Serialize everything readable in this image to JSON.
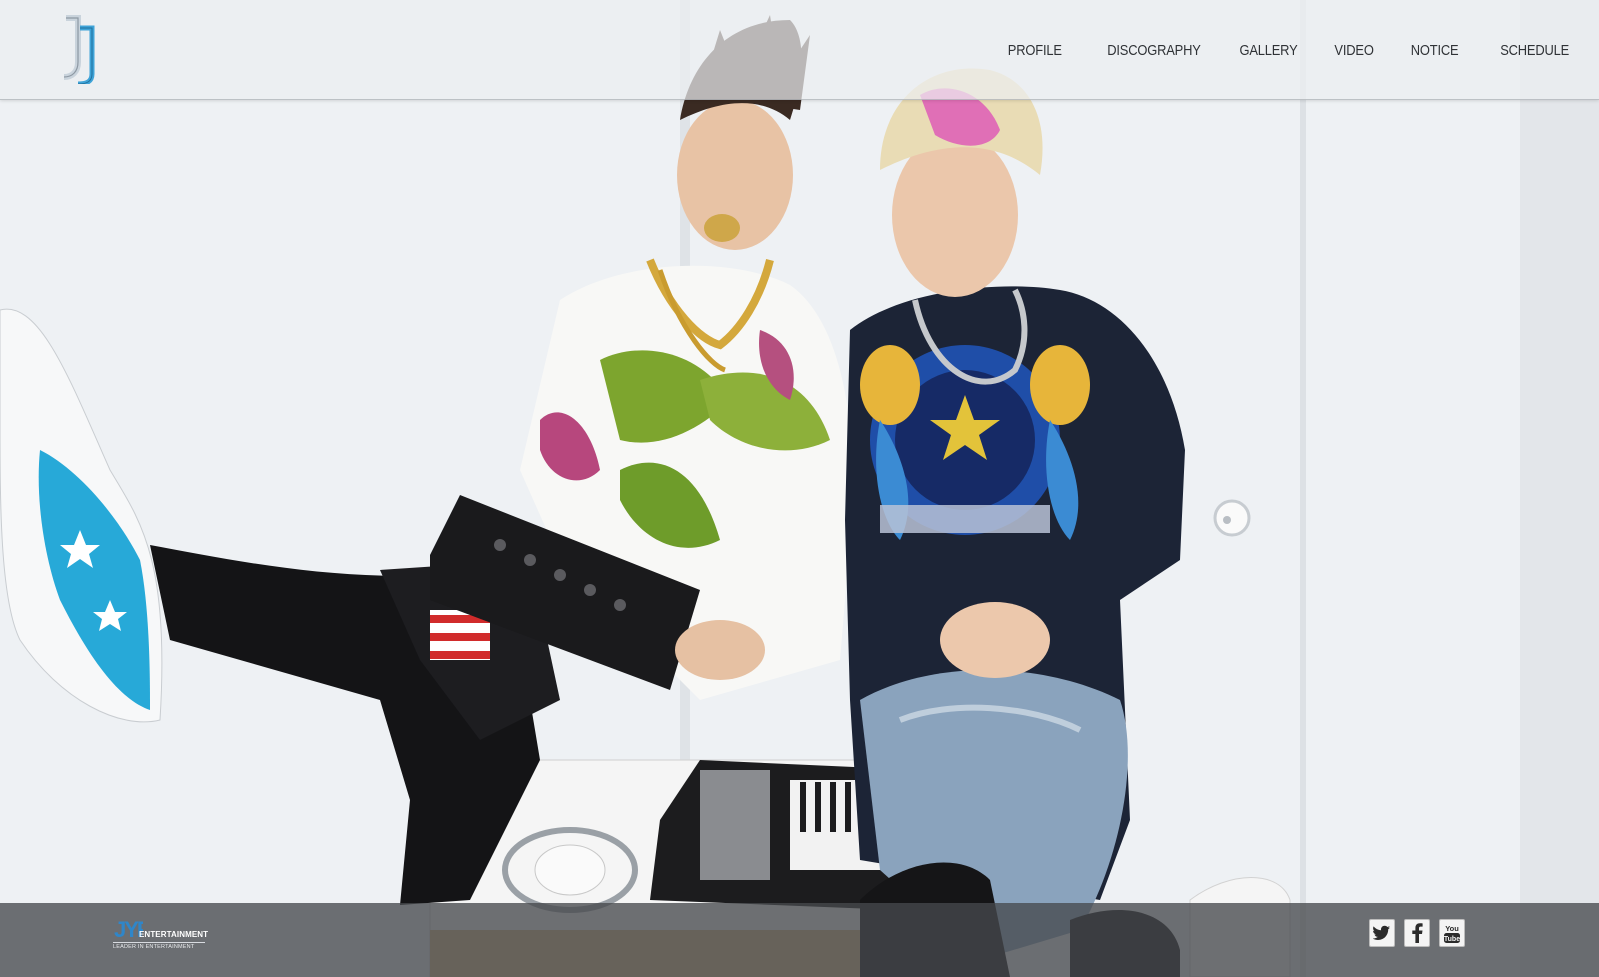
{
  "header": {
    "logo_text": "JJ",
    "nav": [
      {
        "label": "PROFILE"
      },
      {
        "label": "DISCOGRAPHY"
      },
      {
        "label": "GALLERY"
      },
      {
        "label": "VIDEO"
      },
      {
        "label": "NOTICE"
      },
      {
        "label": "SCHEDULE"
      }
    ]
  },
  "hero": {
    "photo_description_icon": "hero-photo"
  },
  "footer": {
    "label_logo_mark": "JYP",
    "label_logo_name": "ENTERTAINMENT",
    "label_logo_tagline": "LEADER IN ENTERTAINMENT",
    "social": [
      {
        "icon": "twitter-icon"
      },
      {
        "icon": "facebook-icon"
      },
      {
        "icon": "youtube-icon",
        "text": "You Tube"
      }
    ]
  },
  "colors": {
    "nav_text": "#2f3236",
    "logo_blue": "#3ea3d8",
    "footer_bg": "#46494d"
  }
}
